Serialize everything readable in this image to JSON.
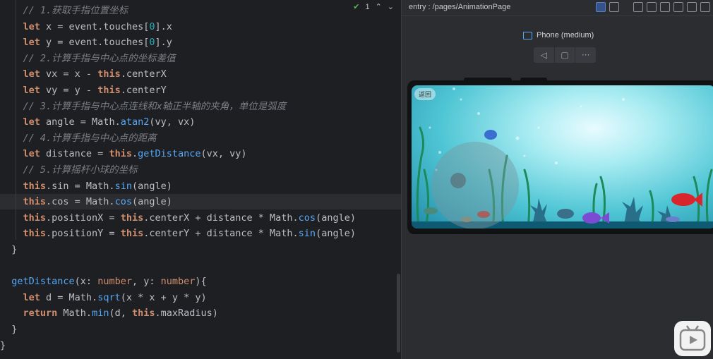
{
  "editor": {
    "status": {
      "check_count": "1"
    },
    "lines": [
      [
        [
          "cm",
          "    // 1.获取手指位置坐标"
        ]
      ],
      [
        [
          "kw",
          "    let"
        ],
        [
          "pr",
          " x = event.touches["
        ],
        [
          "num",
          "0"
        ],
        [
          "pr",
          "].x"
        ]
      ],
      [
        [
          "kw",
          "    let"
        ],
        [
          "pr",
          " y = event.touches["
        ],
        [
          "num",
          "0"
        ],
        [
          "pr",
          "].y"
        ]
      ],
      [
        [
          "cm",
          "    // 2.计算手指与中心点的坐标差值"
        ]
      ],
      [
        [
          "kw",
          "    let"
        ],
        [
          "pr",
          " vx = x - "
        ],
        [
          "kw",
          "this"
        ],
        [
          "pr",
          ".centerX"
        ]
      ],
      [
        [
          "kw",
          "    let"
        ],
        [
          "pr",
          " vy = y - "
        ],
        [
          "kw",
          "this"
        ],
        [
          "pr",
          ".centerY"
        ]
      ],
      [
        [
          "cm",
          "    // 3.计算手指与中心点连线和x轴正半轴的夹角，单位是弧度"
        ]
      ],
      [
        [
          "kw",
          "    let"
        ],
        [
          "pr",
          " angle = Math."
        ],
        [
          "fn",
          "atan2"
        ],
        [
          "pr",
          "(vy, vx)"
        ]
      ],
      [
        [
          "cm",
          "    // 4.计算手指与中心点的距离"
        ]
      ],
      [
        [
          "kw",
          "    let"
        ],
        [
          "pr",
          " distance = "
        ],
        [
          "kw",
          "this"
        ],
        [
          "pr",
          "."
        ],
        [
          "fn",
          "getDistance"
        ],
        [
          "pr",
          "(vx, vy)"
        ]
      ],
      [
        [
          "cm",
          "    // 5.计算摇杆小球的坐标"
        ]
      ],
      [
        [
          "kw",
          "    this"
        ],
        [
          "pr",
          ".sin = Math."
        ],
        [
          "fn",
          "sin"
        ],
        [
          "pr",
          "(angle)"
        ]
      ],
      [
        [
          "kw",
          "    this"
        ],
        [
          "pr",
          ".cos = Math."
        ],
        [
          "fn",
          "cos"
        ],
        [
          "pr",
          "(angle)"
        ]
      ],
      [
        [
          "kw",
          "    this"
        ],
        [
          "pr",
          ".positionX = "
        ],
        [
          "kw",
          "this"
        ],
        [
          "pr",
          ".centerX + distance * Math."
        ],
        [
          "fn",
          "cos"
        ],
        [
          "pr",
          "(angle)"
        ]
      ],
      [
        [
          "kw",
          "    this"
        ],
        [
          "pr",
          ".positionY = "
        ],
        [
          "kw",
          "this"
        ],
        [
          "pr",
          ".centerY + distance * Math."
        ],
        [
          "fn",
          "sin"
        ],
        [
          "pr",
          "(angle)"
        ]
      ],
      [
        [
          "pr",
          "  }"
        ]
      ],
      [
        [
          "pr",
          ""
        ]
      ],
      [
        [
          "fn",
          "  getDistance"
        ],
        [
          "pr",
          "(x: "
        ],
        [
          "ty",
          "number"
        ],
        [
          "pr",
          ", y: "
        ],
        [
          "ty",
          "number"
        ],
        [
          "pr",
          "){"
        ]
      ],
      [
        [
          "kw",
          "    let"
        ],
        [
          "pr",
          " d = Math."
        ],
        [
          "fn",
          "sqrt"
        ],
        [
          "pr",
          "(x * x + y * y)"
        ]
      ],
      [
        [
          "kw",
          "    return"
        ],
        [
          "pr",
          " Math."
        ],
        [
          "fn",
          "min"
        ],
        [
          "pr",
          "(d, "
        ],
        [
          "kw",
          "this"
        ],
        [
          "pr",
          ".maxRadius)"
        ]
      ],
      [
        [
          "pr",
          "  }"
        ]
      ],
      [
        [
          "pr",
          "}"
        ]
      ]
    ]
  },
  "preview": {
    "title": "entry : /pages/AnimationPage",
    "device": "Phone (medium)",
    "nav": [
      "◁",
      "▢",
      "···"
    ],
    "back_label": "返回"
  },
  "colors": {
    "editor_bg": "#1e1f22",
    "keyword": "#cf8e6d",
    "function": "#56a8f5",
    "comment": "#7a7e85",
    "number": "#2aacb8"
  }
}
